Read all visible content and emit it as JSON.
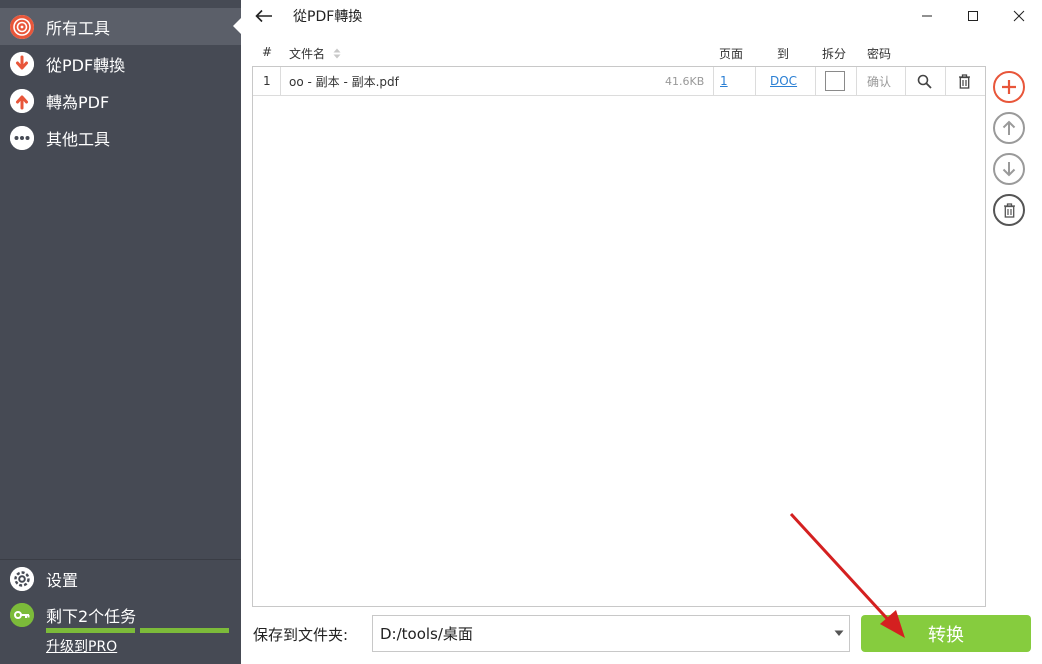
{
  "sidebar": {
    "items": [
      {
        "label": "所有工具",
        "icon": "target-icon"
      },
      {
        "label": "從PDF轉換",
        "icon": "arrow-down-icon"
      },
      {
        "label": "轉為PDF",
        "icon": "arrow-up-icon"
      },
      {
        "label": "其他工具",
        "icon": "more-dots-icon"
      }
    ],
    "settings_label": "设置",
    "tasks_label": "剩下2个任务",
    "upgrade_label": "升级到PRO"
  },
  "window": {
    "title": "從PDF轉換"
  },
  "table": {
    "headers": {
      "index": "#",
      "filename": "文件名",
      "pages": "页面",
      "to": "到",
      "split": "拆分",
      "password": "密码"
    },
    "rows": [
      {
        "index": "1",
        "filename": "oo - 副本 - 副本.pdf",
        "size": "41.6KB",
        "pages": "1",
        "to": "DOC",
        "split": false,
        "password_placeholder": "确认"
      }
    ]
  },
  "bottom": {
    "save_to_label": "保存到文件夹:",
    "folder_value": "D:/tools/桌面",
    "convert_label": "转换"
  },
  "colors": {
    "sidebar_bg": "#464a54",
    "sidebar_active": "#5b5f69",
    "accent_red": "#e8563a",
    "convert_green": "#86cc3e",
    "progress_green": "#7cbb3a",
    "link_blue": "#2a7fd4"
  }
}
